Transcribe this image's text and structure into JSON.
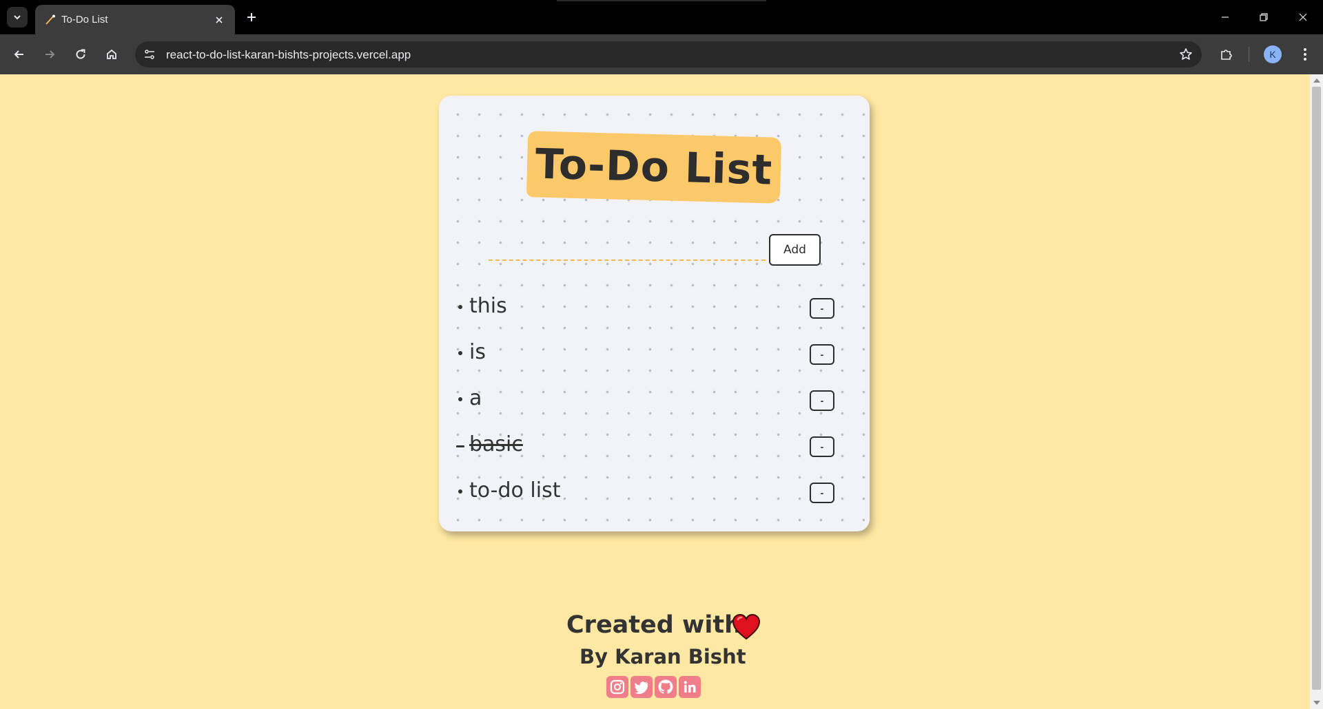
{
  "browser": {
    "tab_title": "To-Do List",
    "url": "react-to-do-list-karan-bishts-projects.vercel.app",
    "profile_initial": "K"
  },
  "app": {
    "title": "To-Do List",
    "input_value": "",
    "add_label": "Add",
    "delete_label": "-",
    "items": [
      {
        "text": "this",
        "done": false
      },
      {
        "text": "is",
        "done": false
      },
      {
        "text": "a",
        "done": false
      },
      {
        "text": "basic",
        "done": true
      },
      {
        "text": "to-do list",
        "done": false
      }
    ]
  },
  "footer": {
    "created_with": "Created with",
    "author": "By Karan Bisht",
    "social": [
      "instagram",
      "twitter",
      "github",
      "linkedin"
    ]
  },
  "colors": {
    "page_bg": "#ffe8a3",
    "title_highlight": "#fbc96a",
    "input_underline": "#f2b84b",
    "heart": "#e0111f",
    "social_icon_bg": "#ef7d8a"
  }
}
